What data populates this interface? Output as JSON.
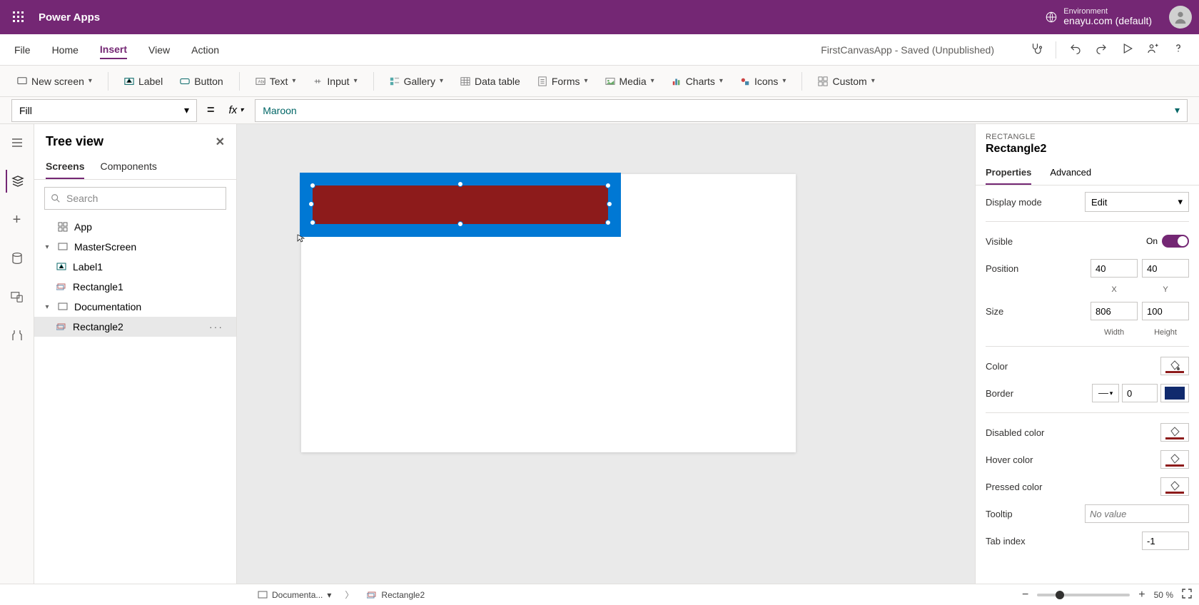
{
  "brand": "Power Apps",
  "environment": {
    "label": "Environment",
    "value": "enayu.com (default)"
  },
  "menubar": {
    "items": [
      "File",
      "Home",
      "Insert",
      "View",
      "Action"
    ],
    "activeIndex": 2,
    "docStatus": "FirstCanvasApp - Saved (Unpublished)"
  },
  "ribbon": {
    "newScreen": "New screen",
    "label": "Label",
    "button": "Button",
    "text": "Text",
    "input": "Input",
    "gallery": "Gallery",
    "dataTable": "Data table",
    "forms": "Forms",
    "media": "Media",
    "charts": "Charts",
    "icons": "Icons",
    "custom": "Custom"
  },
  "formula": {
    "property": "Fill",
    "value": "Maroon"
  },
  "treeView": {
    "title": "Tree view",
    "tabs": [
      "Screens",
      "Components"
    ],
    "activeTab": 0,
    "searchPlaceholder": "Search",
    "items": {
      "app": "App",
      "masterScreen": "MasterScreen",
      "label1": "Label1",
      "rectangle1": "Rectangle1",
      "documentation": "Documentation",
      "rectangle2": "Rectangle2"
    }
  },
  "props": {
    "category": "RECTANGLE",
    "name": "Rectangle2",
    "tabs": [
      "Properties",
      "Advanced"
    ],
    "activeTab": 0,
    "displayModeLabel": "Display mode",
    "displayModeValue": "Edit",
    "visibleLabel": "Visible",
    "visibleValue": "On",
    "positionLabel": "Position",
    "posX": "40",
    "posY": "40",
    "posXLab": "X",
    "posYLab": "Y",
    "sizeLabel": "Size",
    "width": "806",
    "height": "100",
    "widthLab": "Width",
    "heightLab": "Height",
    "colorLabel": "Color",
    "borderLabel": "Border",
    "borderWidth": "0",
    "disabledColorLabel": "Disabled color",
    "hoverColorLabel": "Hover color",
    "pressedColorLabel": "Pressed color",
    "tooltipLabel": "Tooltip",
    "tooltipPlaceholder": "No value",
    "tabIndexLabel": "Tab index",
    "tabIndexValue": "-1"
  },
  "colors": {
    "maroon": "#8d1b1b",
    "navy": "#102a6d"
  },
  "footer": {
    "crumb1": "Documenta...",
    "crumb2": "Rectangle2",
    "zoom": "50",
    "zoomPct": "%"
  }
}
